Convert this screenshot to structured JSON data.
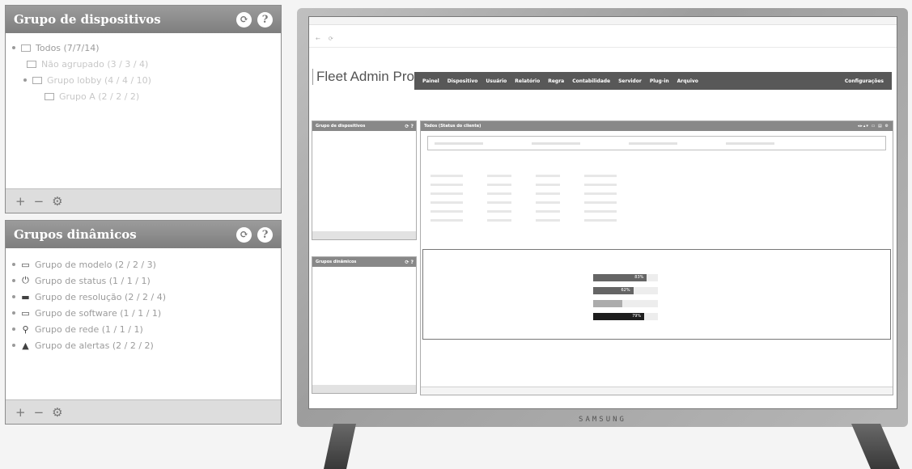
{
  "device_groups_panel": {
    "title": "Grupo de dispositivos",
    "tree": [
      {
        "label": "Todos (7/7/14)",
        "level": 0
      },
      {
        "label": "Não agrupado (3 / 3 / 4)",
        "level": 1
      },
      {
        "label": "Grupo lobby (4 / 4 / 10)",
        "level": 1
      },
      {
        "label": "Grupo A (2 / 2 / 2)",
        "level": 2
      }
    ],
    "footer": [
      "+",
      "−",
      "⚙"
    ]
  },
  "dynamic_groups_panel": {
    "title": "Grupos dinâmicos",
    "items": [
      {
        "label": "Grupo de modelo (2 / 2 / 3)",
        "icon": "monitor-icon"
      },
      {
        "label": "Grupo de status (1 / 1 / 1)",
        "icon": "power-icon"
      },
      {
        "label": "Grupo de resolução (2 / 2 / 4)",
        "icon": "display-icon"
      },
      {
        "label": "Grupo de software (1 / 1 / 1)",
        "icon": "monitor-icon"
      },
      {
        "label": "Grupo de rede (1 / 1 / 1)",
        "icon": "network-icon"
      },
      {
        "label": "Grupo de alertas (2 / 2 / 2)",
        "icon": "warning-icon"
      }
    ],
    "footer": [
      "+",
      "−",
      "⚙"
    ]
  },
  "monitor": {
    "brand": "SAMSUNG",
    "app": {
      "logo": "Fleet Admin Pro",
      "nav": [
        "Painel",
        "Dispositivo",
        "Usuário",
        "Relatório",
        "Regra",
        "Contabilidade",
        "Servidor",
        "Plug-in",
        "Arquivo"
      ],
      "nav_config": "Configurações",
      "side_top_title": "Grupo de dispositivos",
      "side_bottom_title": "Grupos dinâmicos",
      "main_title": "Todos  (Status do cliente)",
      "detail_bars": [
        {
          "label": "83%",
          "value": 0.83
        },
        {
          "label": "62%",
          "value": 0.62
        },
        {
          "label": "",
          "value": 0.45
        },
        {
          "label": "79%",
          "value": 0.79
        }
      ]
    }
  }
}
